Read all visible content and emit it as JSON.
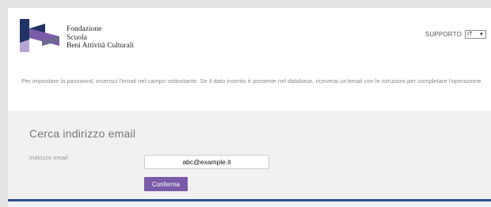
{
  "header": {
    "logo_lines": [
      "Fondazione",
      "Scuola",
      "Beni Attività Culturali"
    ],
    "support_label": "SUPPORTO",
    "language": "IT",
    "language_options": [
      "IT"
    ]
  },
  "instructions": "Per impostare la password, inserisci l'email nel campo sottostante. Se il dato inserito è presente nel database, riceverai un'email con le istruzioni per completare l'operazione.",
  "form": {
    "title": "Cerca indirizzo email",
    "email_label": "Indirizzo email",
    "email_value": "abc@example.it",
    "submit_label": "Conferma"
  },
  "colors": {
    "page_background": "#e3e3e3",
    "panel_background": "#f1f1f1",
    "button_purple": "#7a5ba7",
    "rule_blue": "#2d4e93",
    "logo_navy": "#223366",
    "logo_purple": "#7b5ba8",
    "logo_lavender": "#b7a6d4"
  }
}
